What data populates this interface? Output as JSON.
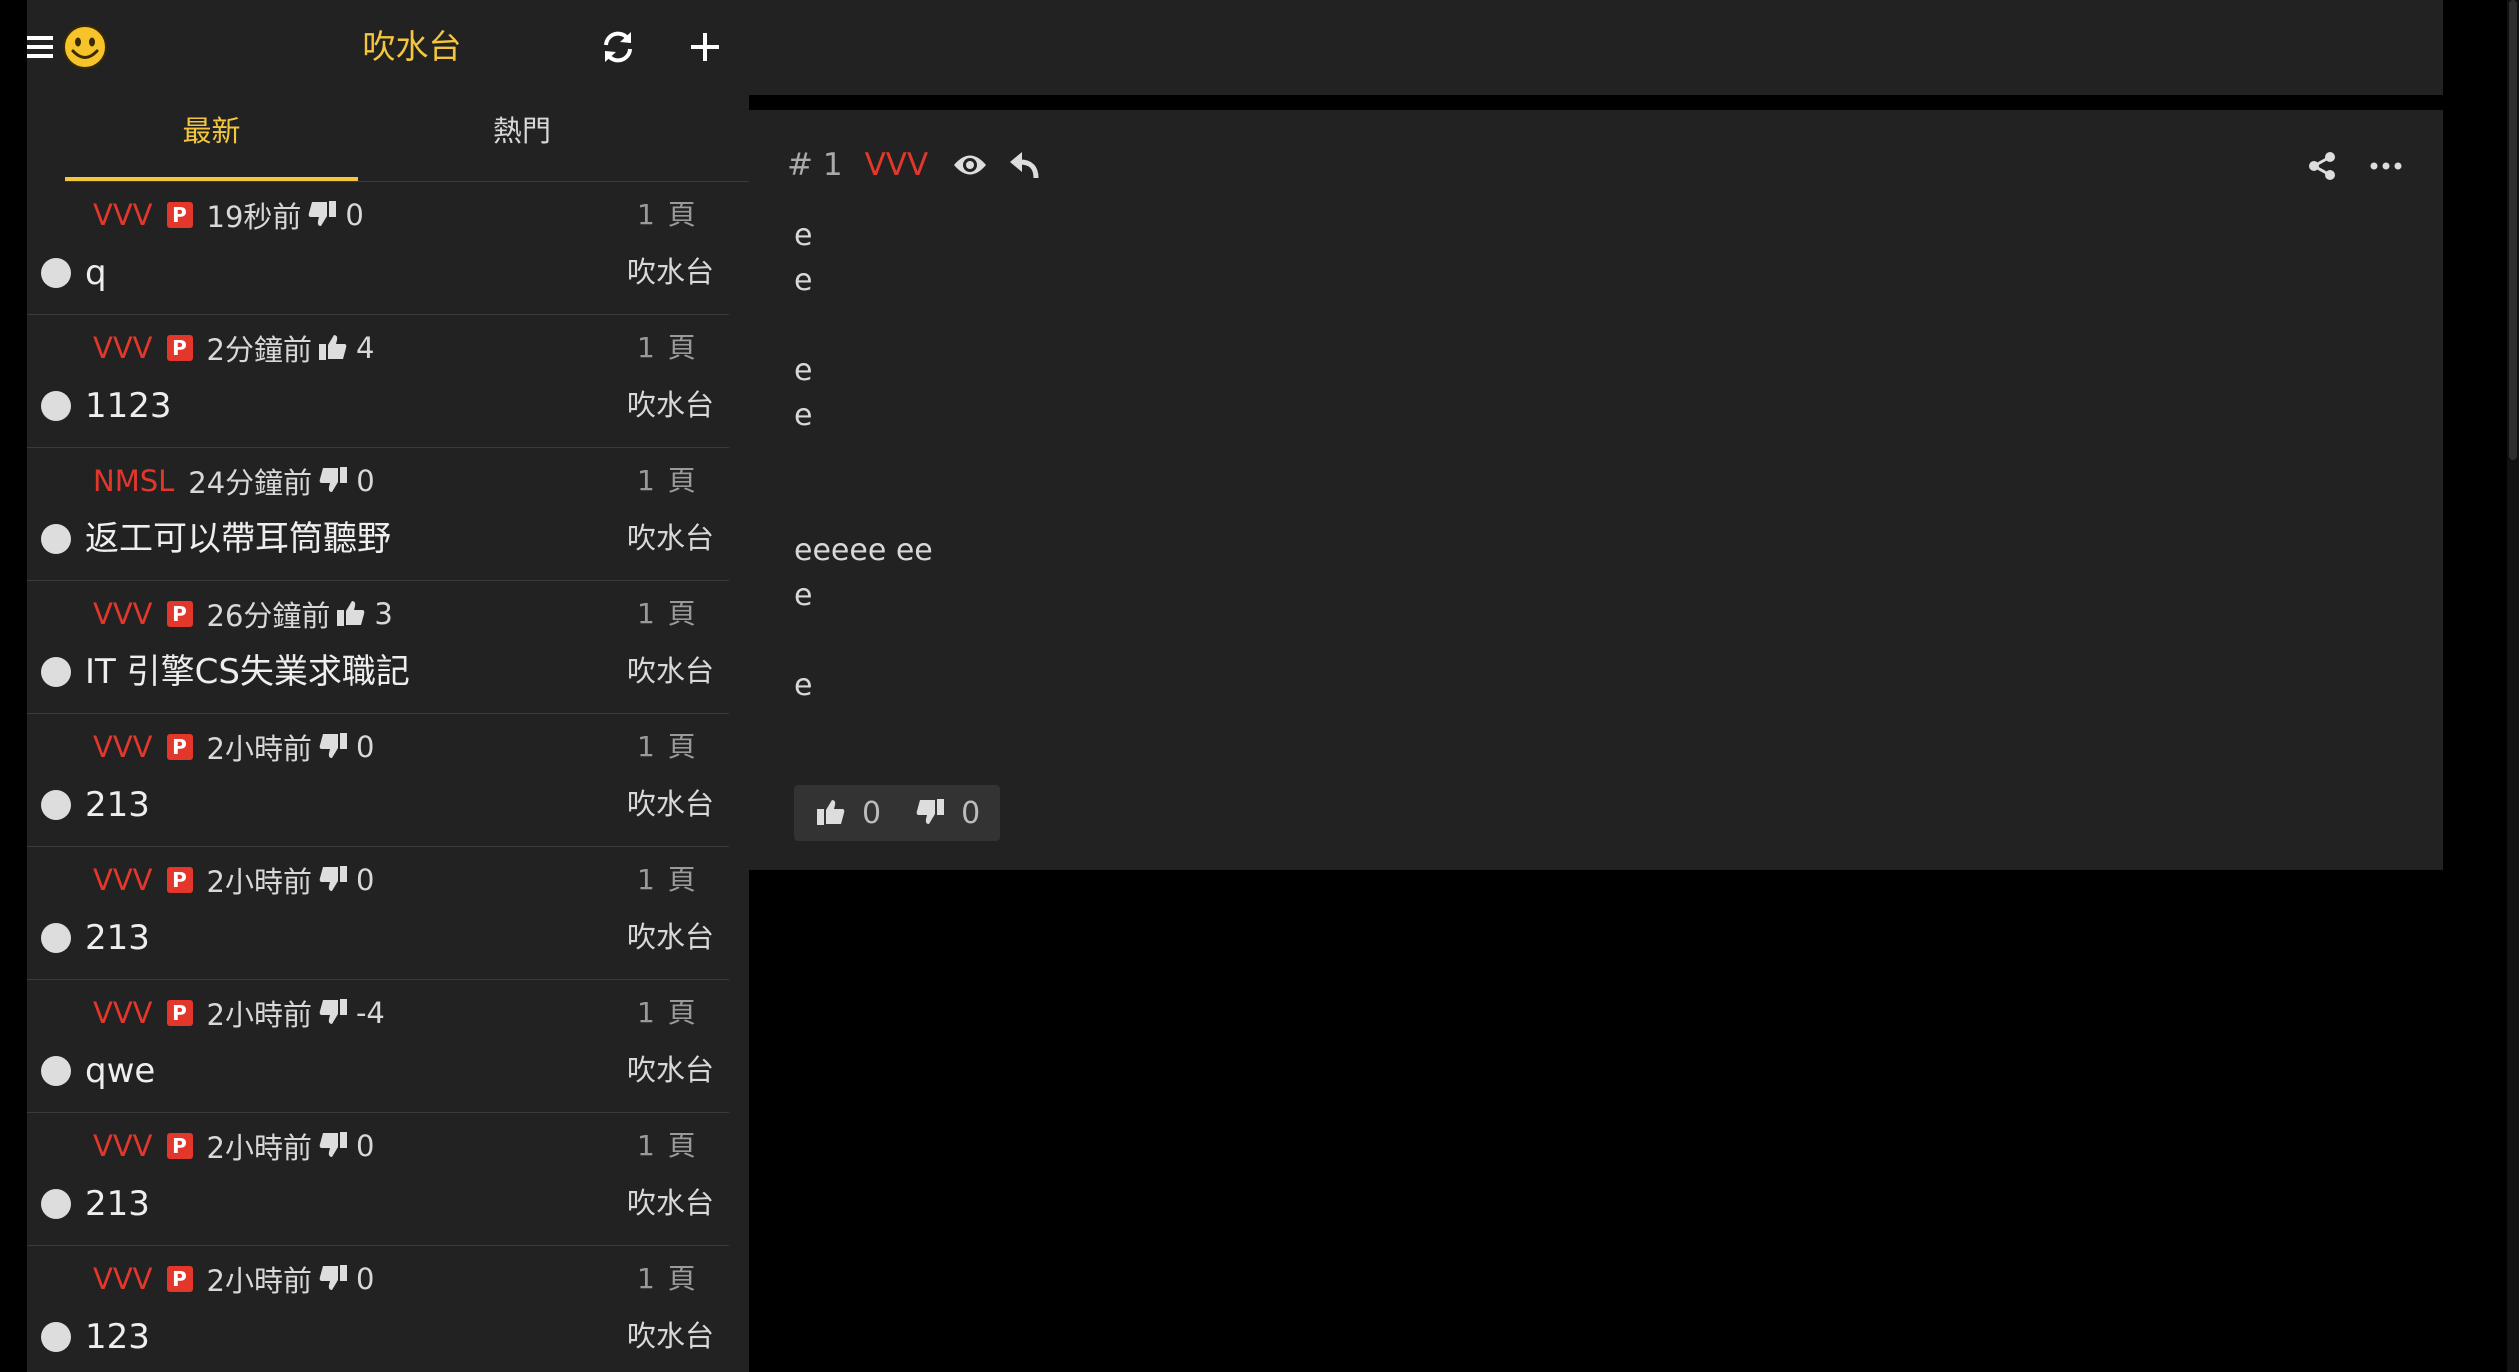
{
  "board_title": "吹水台",
  "tabs": {
    "latest": "最新",
    "hot": "熱門"
  },
  "threads": [
    {
      "user": "VVV",
      "badge": "P",
      "time": "19秒前",
      "vote": "down",
      "score": "0",
      "pages": "1 頁",
      "title": "q",
      "board": "吹水台"
    },
    {
      "user": "VVV",
      "badge": "P",
      "time": "2分鐘前",
      "vote": "up",
      "score": "4",
      "pages": "1 頁",
      "title": "1123",
      "board": "吹水台"
    },
    {
      "user": "NMSL",
      "badge": "",
      "time": "24分鐘前",
      "vote": "down",
      "score": "0",
      "pages": "1 頁",
      "title": "返工可以帶耳筒聽野",
      "board": "吹水台"
    },
    {
      "user": "VVV",
      "badge": "P",
      "time": "26分鐘前",
      "vote": "up",
      "score": "3",
      "pages": "1 頁",
      "title": "IT 引擎CS失業求職記",
      "board": "吹水台"
    },
    {
      "user": "VVV",
      "badge": "P",
      "time": "2小時前",
      "vote": "down",
      "score": "0",
      "pages": "1 頁",
      "title": "213",
      "board": "吹水台"
    },
    {
      "user": "VVV",
      "badge": "P",
      "time": "2小時前",
      "vote": "down",
      "score": "0",
      "pages": "1 頁",
      "title": "213",
      "board": "吹水台"
    },
    {
      "user": "VVV",
      "badge": "P",
      "time": "2小時前",
      "vote": "down",
      "score": "-4",
      "pages": "1 頁",
      "title": "qwe",
      "board": "吹水台"
    },
    {
      "user": "VVV",
      "badge": "P",
      "time": "2小時前",
      "vote": "down",
      "score": "0",
      "pages": "1 頁",
      "title": "213",
      "board": "吹水台"
    },
    {
      "user": "VVV",
      "badge": "P",
      "time": "2小時前",
      "vote": "down",
      "score": "0",
      "pages": "1 頁",
      "title": "123",
      "board": "吹水台"
    }
  ],
  "post": {
    "number": "# 1",
    "user": "VVV",
    "body_lines": [
      "e",
      "e",
      "",
      "e",
      "e",
      "",
      "",
      "eeeee ee",
      "e",
      "",
      "e"
    ],
    "upvotes": "0",
    "downvotes": "0"
  },
  "colors": {
    "accent": "#f4c63d",
    "username": "#e3372c",
    "panel": "#222222"
  },
  "icons": [
    "menu-icon",
    "smiley-icon",
    "refresh-icon",
    "add-icon",
    "thumbs-up-icon",
    "thumbs-down-icon",
    "eye-icon",
    "reply-icon",
    "share-icon",
    "more-icon"
  ]
}
